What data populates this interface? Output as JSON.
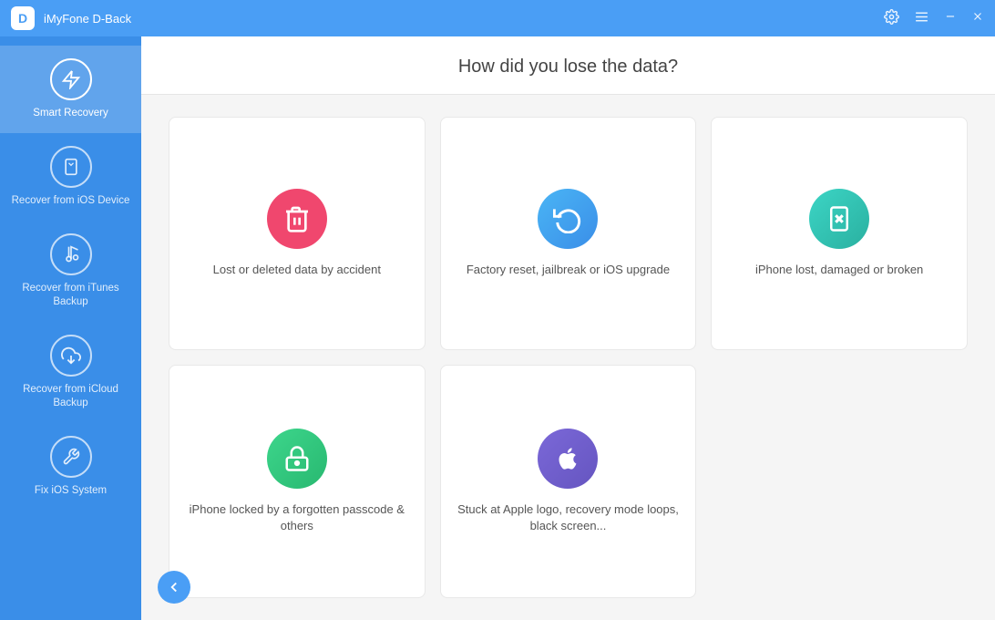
{
  "titleBar": {
    "logo": "D",
    "title": "iMyFone D-Back",
    "settingsLabel": "⚙",
    "menuLabel": "≡",
    "minimizeLabel": "–",
    "closeLabel": "✕"
  },
  "sidebar": {
    "items": [
      {
        "id": "smart-recovery",
        "label": "Smart Recovery",
        "icon": "lightning",
        "active": true
      },
      {
        "id": "recover-ios",
        "label": "Recover from iOS Device",
        "icon": "phone",
        "active": false
      },
      {
        "id": "recover-itunes",
        "label": "Recover from iTunes Backup",
        "icon": "music-note",
        "active": false
      },
      {
        "id": "recover-icloud",
        "label": "Recover from iCloud Backup",
        "icon": "cloud",
        "active": false
      },
      {
        "id": "fix-ios",
        "label": "Fix iOS System",
        "icon": "wrench",
        "active": false
      }
    ]
  },
  "content": {
    "heading": "How did you lose the data?",
    "cards": [
      {
        "id": "lost-deleted",
        "iconColor": "pink",
        "iconType": "trash",
        "label": "Lost or deleted data by accident"
      },
      {
        "id": "factory-reset",
        "iconColor": "blue",
        "iconType": "refresh",
        "label": "Factory reset, jailbreak or iOS upgrade"
      },
      {
        "id": "iphone-lost",
        "iconColor": "teal",
        "iconType": "phone-broken",
        "label": "iPhone lost, damaged or broken"
      },
      {
        "id": "iphone-locked",
        "iconColor": "green",
        "iconType": "lock",
        "label": "iPhone locked by a forgotten passcode & others"
      },
      {
        "id": "stuck-apple",
        "iconColor": "purple",
        "iconType": "apple",
        "label": "Stuck at Apple logo, recovery mode loops, black screen..."
      }
    ],
    "backButton": "←"
  }
}
